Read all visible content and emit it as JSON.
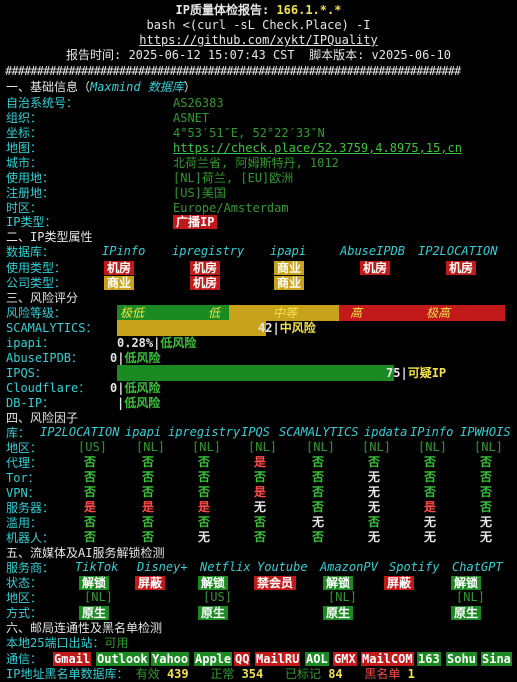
{
  "header": {
    "title_pre": "IP质量体检报告: ",
    "ip": "166.1.*.*",
    "cmd": "bash <(curl -sL Check.Place) -I",
    "repo": "https://github.com/xykt/IPQuality",
    "time_line": "报告时间: 2025-06-12 15:07:43 CST  脚本版本: v2025-06-10",
    "divider": "########################################################################"
  },
  "basic": {
    "title_pre": "一、基础信息（",
    "title_src": "Maxmind 数据库",
    "title_post": "）",
    "rows": [
      {
        "label": "自治系统号：",
        "value": "AS26383",
        "kind": "dim"
      },
      {
        "label": "组织：",
        "value": "ASNET",
        "kind": "dim"
      },
      {
        "label": "坐标：",
        "value": "4°53′51″E, 52°22′33″N",
        "kind": "dim"
      },
      {
        "label": "地图：",
        "value": "https://check.place/52.3759,4.8975,15,cn",
        "kind": "link"
      },
      {
        "label": "城市：",
        "value": "北荷兰省, 阿姆斯特丹, 1012",
        "kind": "dim"
      },
      {
        "label": "使用地：",
        "value": "[NL]荷兰, [EU]欧洲",
        "kind": "dim"
      },
      {
        "label": "注册地：",
        "value": "[US]美国",
        "kind": "dim"
      },
      {
        "label": "时区：",
        "value": "Europe/Amsterdam",
        "kind": "dim"
      }
    ],
    "ip_type_label": "IP类型：",
    "ip_type_value": "广播IP"
  },
  "type_attr": {
    "title": "二、IP类型属性",
    "db_label": "数据库：",
    "dbs": [
      "IPinfo",
      "ipregistry",
      "ipapi",
      "AbuseIPDB",
      "IP2LOCATION"
    ],
    "use_label": "使用类型：",
    "use": [
      "机房",
      "机房",
      "商业",
      "机房",
      "机房"
    ],
    "company_label": "公司类型：",
    "company": [
      "商业",
      "机房",
      "商业"
    ]
  },
  "risk": {
    "title": "三、风险评分",
    "level_label": "风险等级：",
    "levels": [
      "极低",
      "低",
      "中等",
      "高",
      "极高"
    ],
    "scam_label": "SCAMALYTICS：",
    "scam_value": "42",
    "scam_text": "中风险",
    "scam_score_pct": 42,
    "ipapi_label": "ipapi：",
    "ipapi_value": "0.28%",
    "ipapi_text": "低风险",
    "abuse_label": "AbuseIPDB：",
    "abuse_value": "0",
    "abuse_text": "低风险",
    "ipqs_label": "IPQS：",
    "ipqs_value": "75",
    "ipqs_text": "可疑IP",
    "ipqs_score_pct": 75,
    "cf_label": "Cloudflare：",
    "cf_value": "0",
    "cf_text": "低风险",
    "dbip_label": "DB-IP：",
    "dbip_text": "低风险"
  },
  "factors": {
    "title": "四、风险因子",
    "lib_label": "库：",
    "cols": [
      "IP2LOCATION",
      "ipapi",
      "ipregistry",
      "IPQS",
      "SCAMALYTICS",
      "ipdata",
      "IPinfo",
      "IPWHOIS"
    ],
    "region_label": "地区：",
    "region": [
      "[US]",
      "[NL]",
      "[NL]",
      "[NL]",
      "[NL]",
      "[NL]",
      "[NL]",
      "[NL]"
    ],
    "rows": [
      {
        "label": "代理：",
        "vals": [
          "否",
          "否",
          "否",
          "是",
          "否",
          "否",
          "否",
          "否"
        ]
      },
      {
        "label": "Tor：",
        "vals": [
          "否",
          "否",
          "否",
          "否",
          "否",
          "无",
          "否",
          "否"
        ]
      },
      {
        "label": "VPN：",
        "vals": [
          "否",
          "否",
          "否",
          "是",
          "否",
          "无",
          "否",
          "否"
        ]
      },
      {
        "label": "服务器：",
        "vals": [
          "是",
          "是",
          "是",
          "无",
          "否",
          "无",
          "是",
          "否"
        ]
      },
      {
        "label": "滥用：",
        "vals": [
          "否",
          "否",
          "否",
          "否",
          "无",
          "否",
          "无",
          "无"
        ]
      },
      {
        "label": "机器人：",
        "vals": [
          "否",
          "否",
          "无",
          "否",
          "否",
          "无",
          "无",
          "无"
        ]
      }
    ]
  },
  "streaming": {
    "title": "五、流媒体及AI服务解锁检测",
    "svc_label": "服务商：",
    "services": [
      "TikTok",
      "Disney+",
      "Netflix",
      "Youtube",
      "AmazonPV",
      "Spotify",
      "ChatGPT"
    ],
    "status_label": "状态：",
    "status": [
      "解锁",
      "屏蔽",
      "解锁",
      "禁会员",
      "解锁",
      "屏蔽",
      "解锁"
    ],
    "region_label": "地区：",
    "region": [
      "[NL]",
      "",
      "[US]",
      "",
      "[NL]",
      "",
      "[NL]"
    ],
    "method_label": "方式：",
    "method": [
      "原生",
      "",
      "原生",
      "",
      "原生",
      "",
      "原生"
    ]
  },
  "mail": {
    "title": "六、邮局连通性及黑名单检测",
    "port_label": "本地25端口出站：",
    "port_value": "可用",
    "comm_label": "通信：",
    "providers": [
      "Gmail",
      "Outlook",
      "Yahoo",
      "Apple",
      "QQ",
      "MailRU",
      "AOL",
      "GMX",
      "MailCOM",
      "163",
      "Sohu",
      "Sina"
    ],
    "blacklist_label": "IP地址黑名单数据库：",
    "bl_valid_label": "有效",
    "bl_valid": "439",
    "bl_normal_label": "正常",
    "bl_normal": "354",
    "bl_marked_label": "已标记",
    "bl_marked": "84",
    "bl_black_label": "黑名单",
    "bl_black": "1"
  }
}
